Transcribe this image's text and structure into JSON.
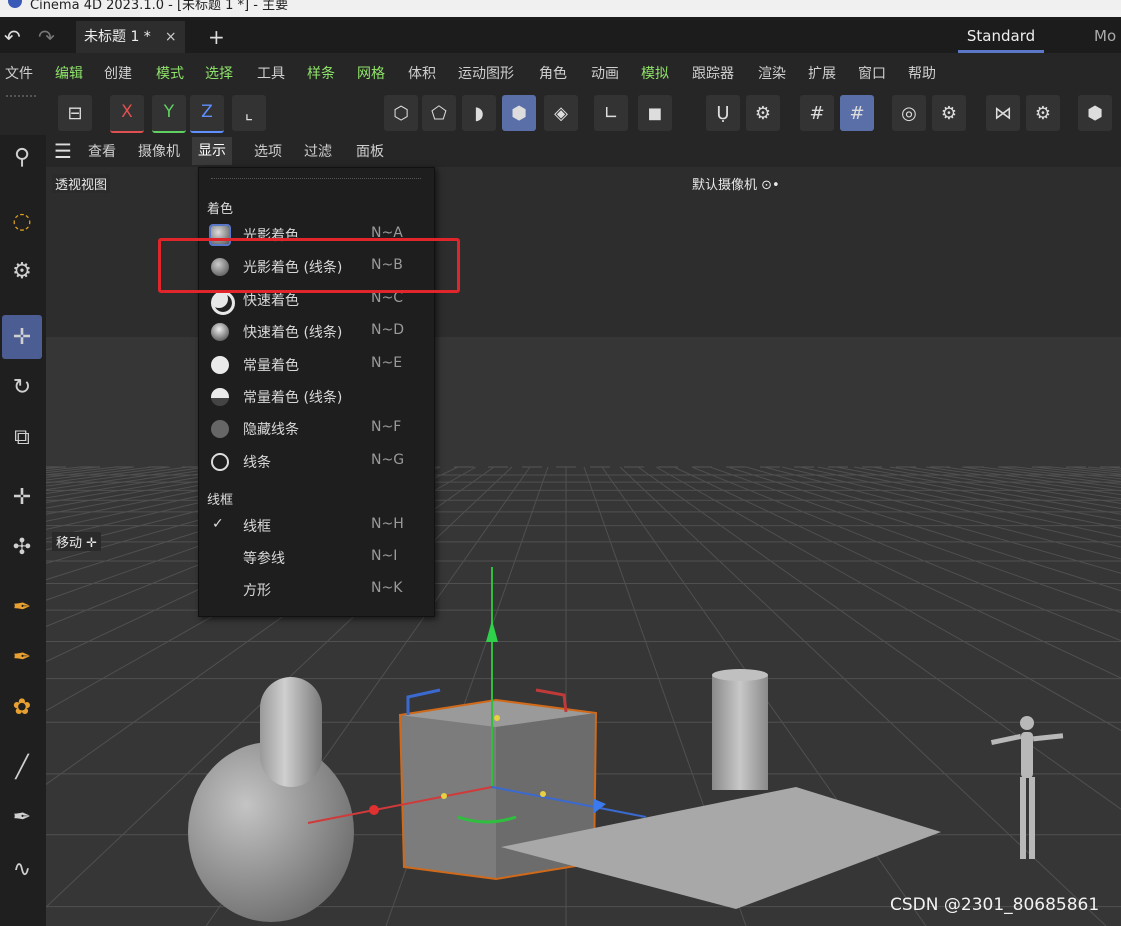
{
  "title_bar": {
    "text": "Cinema 4D 2023.1.0 - [未标题 1 *] - 主要"
  },
  "tabs": {
    "doc_tab": "未标题 1 *",
    "close": "×",
    "add": "+",
    "layout_active": "Standard",
    "layout_next": "Mo"
  },
  "menu": [
    "文件",
    "编辑",
    "创建",
    "模式",
    "选择",
    "工具",
    "样条",
    "网格",
    "体积",
    "运动图形",
    "角色",
    "动画",
    "模拟",
    "跟踪器",
    "渲染",
    "扩展",
    "窗口",
    "帮助"
  ],
  "toolbar": {
    "x": "X",
    "y": "Y",
    "z": "Z"
  },
  "view_menu": {
    "items": [
      "查看",
      "摄像机",
      "显示",
      "选项",
      "过滤",
      "面板"
    ],
    "active_index": 2
  },
  "viewport": {
    "view_label": "透视视图",
    "camera_label": "默认摄像机 ⊙•",
    "move_label": "移动 ✛"
  },
  "dropdown": {
    "section_shading": "着色",
    "section_wireframe": "线框",
    "items": [
      {
        "label": "光影着色",
        "key": "N~A"
      },
      {
        "label": "光影着色 (线条)",
        "key": "N~B"
      },
      {
        "label": "快速着色",
        "key": "N~C"
      },
      {
        "label": "快速着色 (线条)",
        "key": "N~D"
      },
      {
        "label": "常量着色",
        "key": "N~E"
      },
      {
        "label": "常量着色 (线条)",
        "key": ""
      },
      {
        "label": "隐藏线条",
        "key": "N~F"
      },
      {
        "label": "线条",
        "key": "N~G"
      }
    ],
    "wire_items": [
      {
        "label": "线框",
        "key": "N~H",
        "checked": true
      },
      {
        "label": "等参线",
        "key": "N~I"
      },
      {
        "label": "方形",
        "key": "N~K"
      }
    ],
    "check_mark": "✓"
  },
  "watermark": "CSDN @2301_80685861",
  "colors": {
    "highlight_box": "#e0262a",
    "accent": "#5b78c8",
    "menu_green": "#8fe36a"
  }
}
